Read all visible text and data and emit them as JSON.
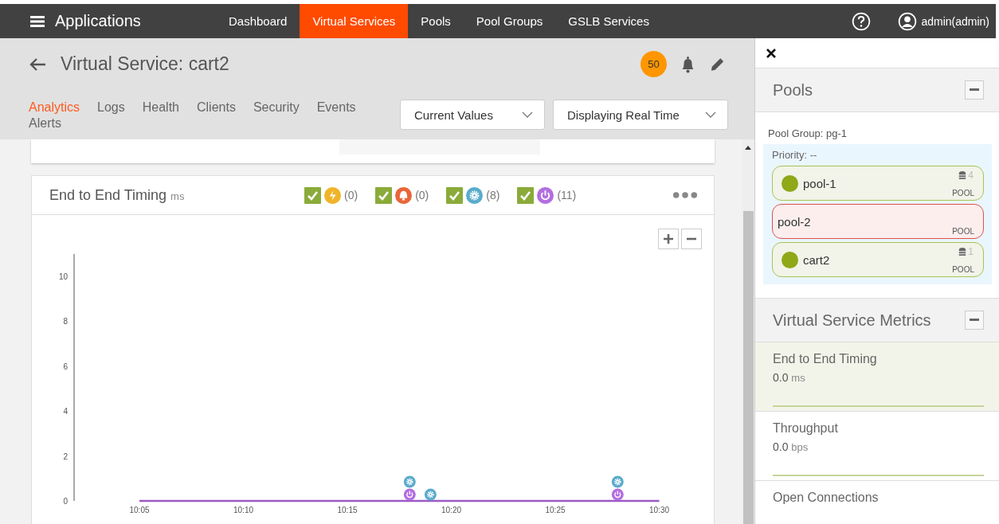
{
  "nav": {
    "title": "Applications",
    "items": [
      {
        "label": "Dashboard",
        "selected": false
      },
      {
        "label": "Virtual Services",
        "selected": true
      },
      {
        "label": "Pools",
        "selected": false
      },
      {
        "label": "Pool Groups",
        "selected": false
      },
      {
        "label": "GSLB Services",
        "selected": false
      }
    ],
    "user": "admin(admin)"
  },
  "header": {
    "title": "Virtual Service: cart2",
    "alert_count": "50"
  },
  "tabs": [
    {
      "label": "Analytics",
      "selected": true
    },
    {
      "label": "Logs",
      "selected": false
    },
    {
      "label": "Health",
      "selected": false
    },
    {
      "label": "Clients",
      "selected": false
    },
    {
      "label": "Security",
      "selected": false
    },
    {
      "label": "Events",
      "selected": false
    },
    {
      "label": "Alerts",
      "selected": false
    }
  ],
  "dropdowns": [
    {
      "value": "Current Values"
    },
    {
      "value": "Displaying Real Time"
    }
  ],
  "chart_card": {
    "title": "End to End Timing",
    "unit": "ms",
    "legend": [
      {
        "kind": "anomaly",
        "checked": true,
        "count": "(0)",
        "color": "#f0b429"
      },
      {
        "kind": "alert",
        "checked": true,
        "count": "(0)",
        "color": "#e8673a"
      },
      {
        "kind": "config",
        "checked": true,
        "count": "(8)",
        "color": "#5aabcc"
      },
      {
        "kind": "system",
        "checked": true,
        "count": "(11)",
        "color": "#b36ee0"
      }
    ],
    "chart_data": {
      "type": "line",
      "x": [
        "10:05",
        "10:10",
        "10:15",
        "10:20",
        "10:25",
        "10:30"
      ],
      "ylim": [
        0,
        11
      ],
      "yticks": [
        0,
        2,
        4,
        6,
        8,
        10
      ],
      "series": [
        {
          "color": "#9b59c6",
          "values": [
            0,
            0,
            0,
            0,
            0,
            0
          ]
        }
      ]
    }
  },
  "side": {
    "pools_title": "Pools",
    "pool_group": "Pool Group: pg-1",
    "priority": "Priority: --",
    "pools": [
      {
        "name": "pool-1",
        "healthy": true,
        "servers": "4",
        "tag": "POOL"
      },
      {
        "name": "pool-2",
        "healthy": false,
        "tag": "POOL"
      },
      {
        "name": "cart2",
        "healthy": true,
        "servers": "1",
        "tag": "POOL"
      }
    ],
    "metrics_title": "Virtual Service Metrics",
    "metrics": [
      {
        "name": "End to End Timing",
        "value": "0.0",
        "unit": "ms",
        "selected": true
      },
      {
        "name": "Throughput",
        "value": "0.0",
        "unit": "bps",
        "selected": false
      },
      {
        "name": "Open Connections",
        "selected": false
      }
    ]
  }
}
